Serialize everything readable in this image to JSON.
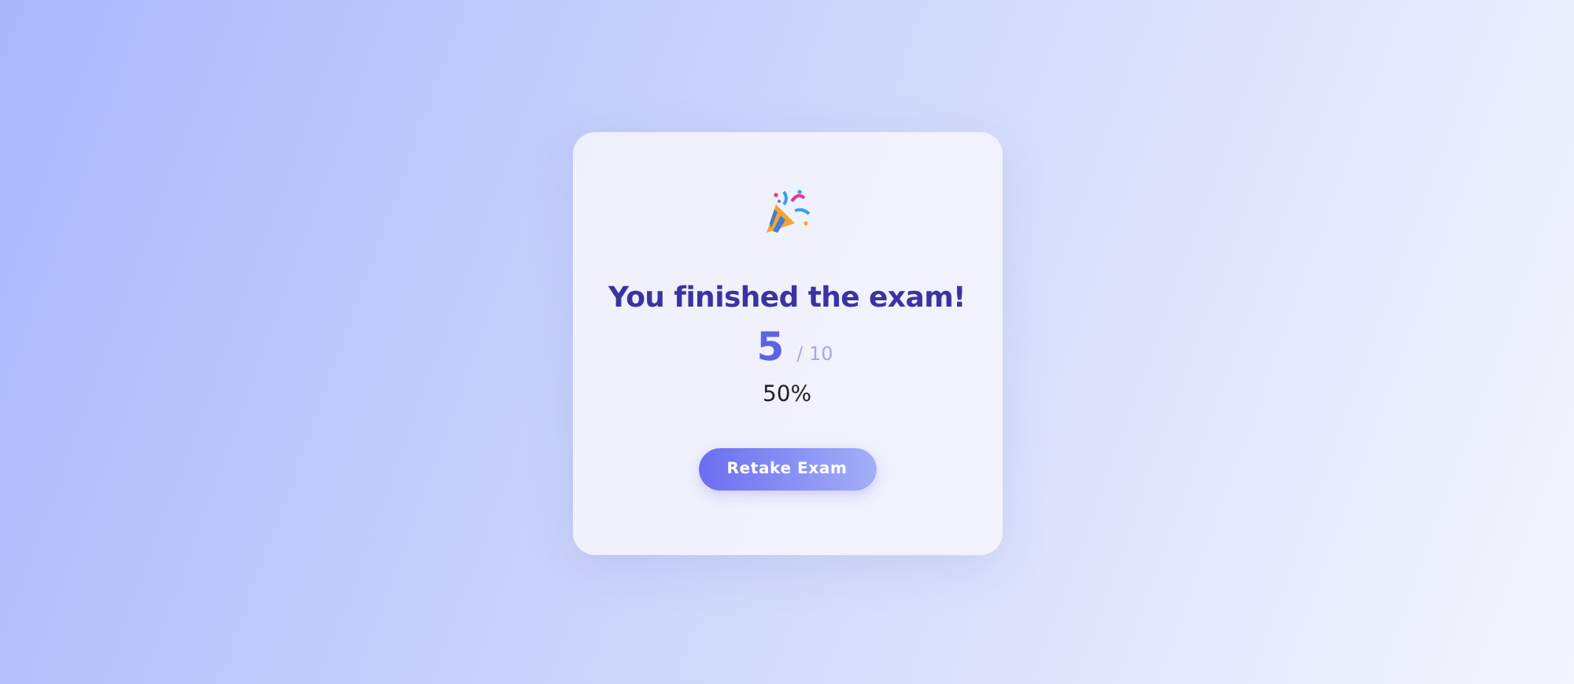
{
  "result": {
    "title": "You finished the exam!",
    "score": "5",
    "total": "/ 10",
    "percent": "50%"
  },
  "buttons": [
    "Retake Exam"
  ]
}
